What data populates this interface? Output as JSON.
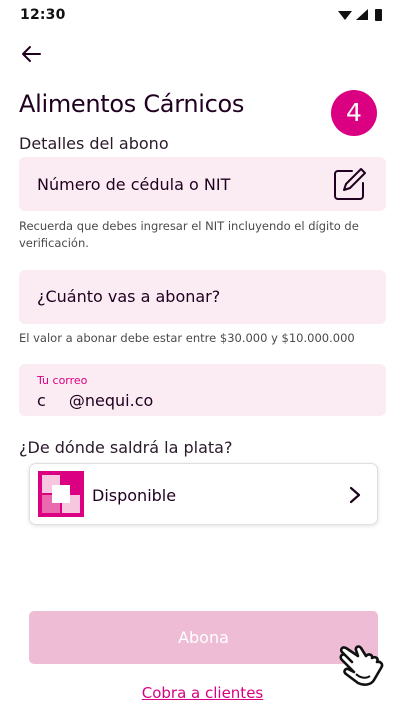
{
  "status_bar": {
    "time": "12:30"
  },
  "header": {
    "title": "Alimentos Cárnicos",
    "step": "4"
  },
  "details": {
    "section_label": "Detalles del abono",
    "id_field": {
      "placeholder": "Número de cédula o NIT",
      "hint": "Recuerda que debes ingresar el NIT incluyendo el dígito de verificación."
    },
    "amount_field": {
      "placeholder": "¿Cuánto vas a abonar?",
      "hint": "El valor a abonar debe estar entre $30.000 y $10.000.000"
    },
    "email_field": {
      "label": "Tu correo",
      "value": "c @nequi.co"
    }
  },
  "source": {
    "question": "¿De dónde saldrá la plata?",
    "selected": "Disponible"
  },
  "actions": {
    "primary_label": "Abona",
    "link_label": "Cobra a clientes"
  },
  "colors": {
    "accent": "#da0081",
    "field_bg": "#fbecf3",
    "button_disabled": "#efbcd5"
  }
}
